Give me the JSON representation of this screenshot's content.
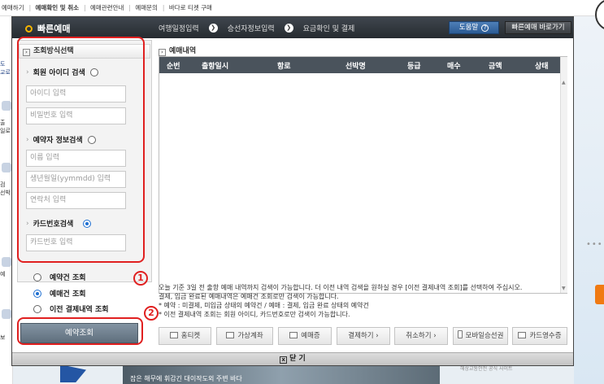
{
  "background": {
    "topnav": [
      "예매하기",
      "예매확인 및 취소",
      "예매관련안내",
      "예매문의",
      "바다로 티켓 구매"
    ],
    "left_labels": [
      "도",
      "교로",
      "출",
      "일로",
      "검",
      "선박",
      "오",
      "예",
      "보"
    ],
    "bottom_caption": "잡은 해무에 휘감긴 대이작도외 주변 바다",
    "bottom_right_text": "해상교통안전 공식 사이트"
  },
  "popup": {
    "title": "빠른예매",
    "steps": [
      "여행일정입력",
      "승선자정보입력",
      "요금확인 및 결제"
    ],
    "step_arrow": "❯",
    "help_label": "도움말",
    "help_glyph": "?",
    "quick_label": "빠른예매 바로가기",
    "search_section_title": "조회방식선택",
    "chev_glyph": "›",
    "gt_glyph": "›",
    "member_search_label": "회원 아이디 검색",
    "id_placeholder": "아이디 입력",
    "password_placeholder": "비밀번호 입력",
    "booker_search_label": "예약자 정보검색",
    "name_placeholder": "이름 입력",
    "birth_placeholder": "생년월일(yymmdd) 입력",
    "phone_placeholder": "연락처 입력",
    "card_search_label": "카드번호검색",
    "card_placeholder": "카드번호 입력",
    "inquiry_options": [
      "예약건 조회",
      "예매건 조회",
      "이전 결제내역 조회"
    ],
    "inquiry_selected_index": 1,
    "search_method_selected": "card",
    "submit_label": "예약조회",
    "results_title": "예매내역",
    "columns": [
      "순번",
      "출항일시",
      "항로",
      "선박명",
      "등급",
      "매수",
      "금액",
      "상태"
    ],
    "notes": [
      "오늘 기준 3일 전 출항 예매 내역까지 검색이 가능합니다. 더 이전 내역 검색을 원하실 경우 [이전 결제내역 조회]를 선택하여 주십시오.",
      "결제, 입금 완료된 예매내역은 예매건 조회로만 검색이 가능합니다.",
      "* 예약 : 미결제, 미입금 상태의 예약건 / 예매 : 결제, 입금 완료 상태의 예약건",
      "* 이전 결제내역 조회는 회원 아이디, 카드번호로만 검색이 가능합니다."
    ],
    "actions": [
      "홈티켓",
      "가상계좌",
      "예매증",
      "결제하기 ›",
      "취소하기 ›",
      "모바일승선권",
      "카드영수증"
    ],
    "close_glyph": "x",
    "close_label": "닫 기"
  },
  "annotations": {
    "one": "1",
    "two": "2",
    "color": "#e02020"
  },
  "colors": {
    "header_dark": "#2b3035",
    "accent_yellow": "#f5b400",
    "radio_blue": "#1f6fd1"
  }
}
